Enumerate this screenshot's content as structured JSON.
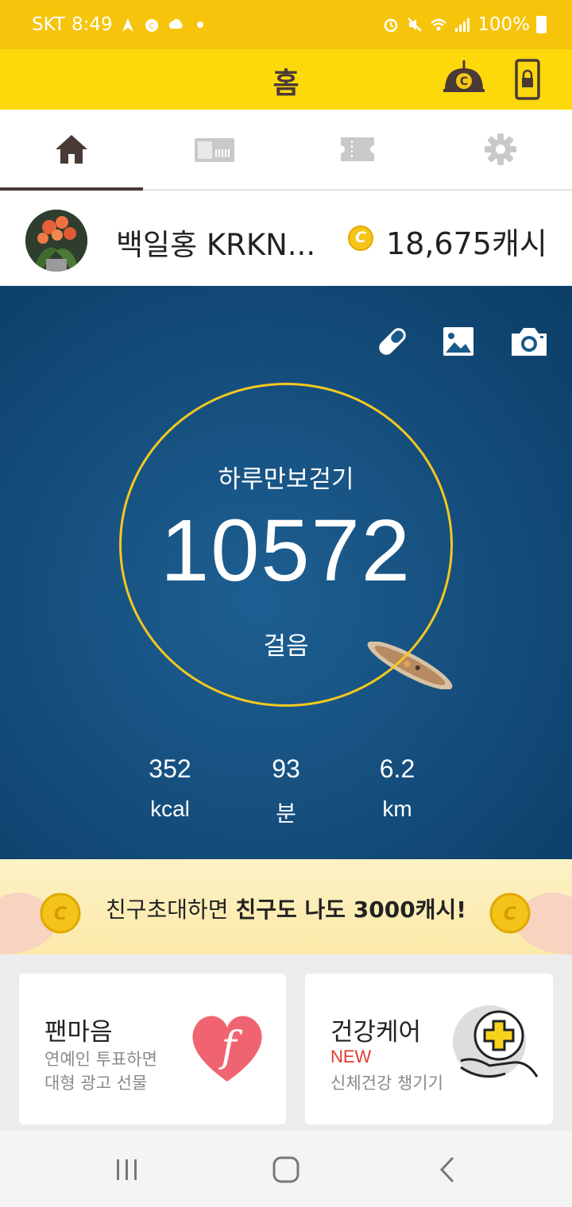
{
  "status_bar": {
    "carrier": "SKT",
    "time": "8:49",
    "battery": "100%",
    "icons_left": [
      "tmap-icon",
      "notification-icon",
      "cloud-icon"
    ],
    "icons_right": [
      "alarm-icon",
      "mute-icon",
      "wifi-icon",
      "signal-icon",
      "battery-icon"
    ]
  },
  "app_bar": {
    "title": "홈",
    "actions": [
      "cash-lock-icon",
      "phone-lock-icon"
    ]
  },
  "tabs": [
    {
      "icon": "home-icon",
      "active": true
    },
    {
      "icon": "gift-card-icon",
      "active": false
    },
    {
      "icon": "ticket-icon",
      "active": false
    },
    {
      "icon": "settings-icon",
      "active": false
    }
  ],
  "profile": {
    "name": "백일홍 KRKN...",
    "coin_symbol": "C",
    "cash": "18,675캐시"
  },
  "hero": {
    "tools": [
      "pill-icon",
      "image-icon",
      "camera-icon"
    ],
    "steps_title": "하루만보걷기",
    "steps": "10572",
    "steps_unit": "걸음",
    "stats": [
      {
        "value": "352",
        "unit": "kcal"
      },
      {
        "value": "93",
        "unit": "분"
      },
      {
        "value": "6.2",
        "unit": "km"
      }
    ]
  },
  "banner": {
    "text_normal": "친구초대하면 ",
    "text_bold": "친구도 나도 3000캐시!"
  },
  "cards": [
    {
      "title": "팬마음",
      "desc1": "연예인 투표하면",
      "desc2": "대형 광고 선물"
    },
    {
      "title": "건강케어",
      "badge": "NEW",
      "desc1": "신체건강 챙기기"
    }
  ],
  "colors": {
    "status_bar": "#f7c40c",
    "app_bar": "#fdd90c",
    "brown": "#4a3a36",
    "ring": "#f4c81f",
    "new_badge": "#e23b2f"
  }
}
